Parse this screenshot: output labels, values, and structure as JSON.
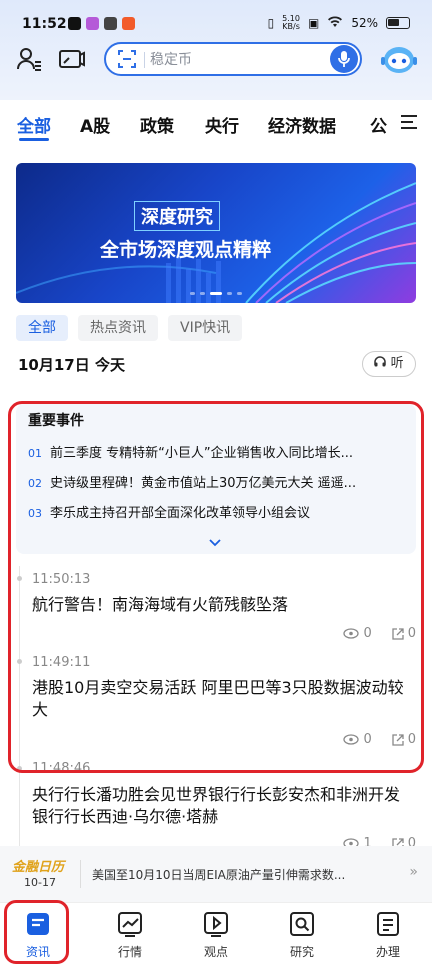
{
  "status_bar": {
    "time": "11:52",
    "net_speed_value": "5.10",
    "net_speed_unit": "KB/s",
    "battery": "52%"
  },
  "search": {
    "placeholder": "稳定币"
  },
  "tabs": [
    {
      "label": "全部"
    },
    {
      "label": "A股"
    },
    {
      "label": "政策"
    },
    {
      "label": "央行"
    },
    {
      "label": "经济数据"
    },
    {
      "label": "公"
    }
  ],
  "banner": {
    "tag": "深度研究",
    "subtitle": "全市场深度观点精粹"
  },
  "subtabs": [
    {
      "label": "全部"
    },
    {
      "label": "热点资讯"
    },
    {
      "label": "VIP快讯"
    }
  ],
  "date_label": "10月17日 今天",
  "listen_label": "听",
  "events": {
    "title": "重要事件",
    "items": [
      {
        "num": "01",
        "text": "前三季度 专精特新“小巨人”企业销售收入同比增长..."
      },
      {
        "num": "02",
        "text": "史诗级里程碑！黄金市值站上30万亿美元大关 遥遥..."
      },
      {
        "num": "03",
        "text": "李乐成主持召开部全面深化改革领导小组会议"
      }
    ]
  },
  "news": [
    {
      "time": "11:50:13",
      "title": "航行警告！南海海域有火箭残骸坠落",
      "views": "0",
      "shares": "0"
    },
    {
      "time": "11:49:11",
      "title": "港股10月卖空交易活跃 阿里巴巴等3只股数据波动较大",
      "views": "0",
      "shares": "0"
    },
    {
      "time": "11:48:46",
      "title": "央行行长潘功胜会见世界银行行长彭安杰和非洲开发银行行长西迪·乌尔德·塔赫",
      "views": "1",
      "shares": "0"
    }
  ],
  "calendar": {
    "logo": "金融日历",
    "date": "10-17",
    "text": "美国至10月10日当周EIA原油产量引伸需求数..."
  },
  "bottom_nav": [
    {
      "label": "资讯"
    },
    {
      "label": "行情"
    },
    {
      "label": "观点"
    },
    {
      "label": "研究"
    },
    {
      "label": "办理"
    }
  ],
  "colors": {
    "accent": "#1a5fe0",
    "highlight_border": "#e0232a",
    "calendar_logo": "#e0a21a"
  }
}
